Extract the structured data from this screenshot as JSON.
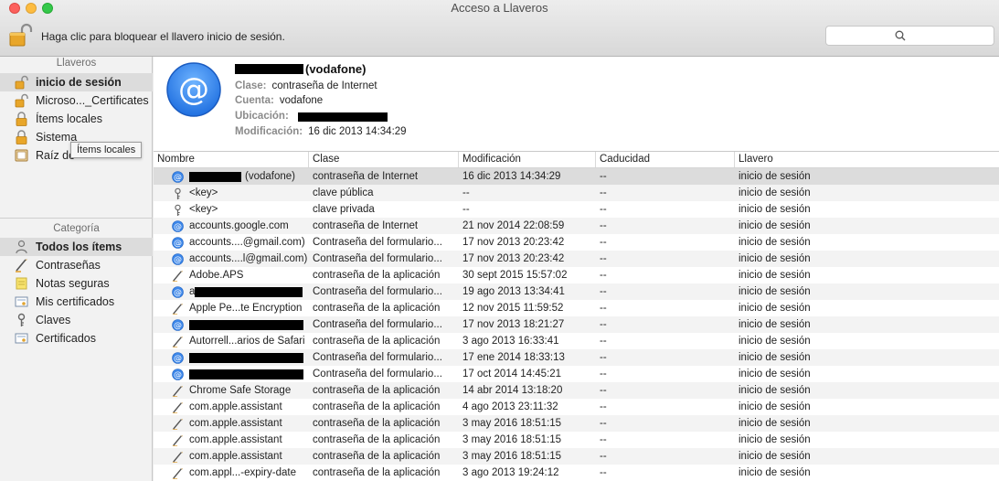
{
  "window": {
    "title": "Acceso a Llaveros"
  },
  "toolbar": {
    "lock_text": "Haga clic para bloquear el llavero inicio de sesión.",
    "search_placeholder": ""
  },
  "sidebar": {
    "keychains_header": "Llaveros",
    "keychains": [
      {
        "label": "inicio de sesión",
        "icon": "lock-open-icon",
        "selected": true
      },
      {
        "label": "Microso..._Certificates",
        "icon": "lock-open-icon",
        "selected": false
      },
      {
        "label": "Ítems locales",
        "icon": "lock-icon",
        "selected": false
      },
      {
        "label": "Sistema",
        "icon": "lock-icon",
        "selected": false
      },
      {
        "label": "Raíz de",
        "icon": "cabinet-icon",
        "selected": false
      }
    ],
    "tooltip": "Ítems locales",
    "category_header": "Categoría",
    "categories": [
      {
        "label": "Todos los ítems",
        "icon": "people-icon",
        "selected": true
      },
      {
        "label": "Contraseñas",
        "icon": "pen-icon",
        "selected": false
      },
      {
        "label": "Notas seguras",
        "icon": "note-icon",
        "selected": false
      },
      {
        "label": "Mis certificados",
        "icon": "certificate-icon",
        "selected": false
      },
      {
        "label": "Claves",
        "icon": "key-icon",
        "selected": false
      },
      {
        "label": "Certificados",
        "icon": "certificate-icon",
        "selected": false
      }
    ]
  },
  "detail": {
    "title": "(vodafone)",
    "clase_label": "Clase:",
    "clase_value": "contraseña de Internet",
    "cuenta_label": "Cuenta:",
    "cuenta_value": "vodafone",
    "ubicacion_label": "Ubicación:",
    "modificacion_label": "Modificación:",
    "modificacion_value": "16 dic 2013 14:34:29"
  },
  "table": {
    "columns": [
      "Nombre",
      "Clase",
      "Modificación",
      "Caducidad",
      "Llavero"
    ],
    "rows": [
      {
        "name": "(vodafone)",
        "redact": "pre",
        "icon": "at-icon",
        "clase": "contraseña de Internet",
        "mod": "16 dic 2013 14:34:29",
        "cad": "--",
        "llavero": "inicio de sesión",
        "selected": true
      },
      {
        "name": "<key>",
        "icon": "key-icon",
        "clase": "clave pública",
        "mod": "--",
        "cad": "--",
        "llavero": "inicio de sesión"
      },
      {
        "name": "<key>",
        "icon": "key-icon",
        "clase": "clave privada",
        "mod": "--",
        "cad": "--",
        "llavero": "inicio de sesión"
      },
      {
        "name": "accounts.google.com",
        "icon": "at-icon",
        "clase": "contraseña de Internet",
        "mod": "21 nov 2014 22:08:59",
        "cad": "--",
        "llavero": "inicio de sesión"
      },
      {
        "name": "accounts....@gmail.com)",
        "icon": "at-icon",
        "clase": "Contraseña del formulario...",
        "mod": "17 nov 2013 20:23:42",
        "cad": "--",
        "llavero": "inicio de sesión"
      },
      {
        "name": "accounts....l@gmail.com)",
        "icon": "at-icon",
        "clase": "Contraseña del formulario...",
        "mod": "17 nov 2013 20:23:42",
        "cad": "--",
        "llavero": "inicio de sesión"
      },
      {
        "name": "Adobe.APS",
        "icon": "pen-icon",
        "clase": "contraseña de la aplicación",
        "mod": "30 sept 2015 15:57:02",
        "cad": "--",
        "llavero": "inicio de sesión"
      },
      {
        "name": "a",
        "redact": "post",
        "icon": "at-icon",
        "clase": "Contraseña del formulario...",
        "mod": "19 ago 2013 13:34:41",
        "cad": "--",
        "llavero": "inicio de sesión"
      },
      {
        "name": "Apple Pe...te Encryption",
        "icon": "pen-icon",
        "clase": "contraseña de la aplicación",
        "mod": "12 nov 2015 11:59:52",
        "cad": "--",
        "llavero": "inicio de sesión"
      },
      {
        "name": "",
        "redact": "full",
        "icon": "at-icon",
        "clase": "Contraseña del formulario...",
        "mod": "17 nov 2013 18:21:27",
        "cad": "--",
        "llavero": "inicio de sesión"
      },
      {
        "name": "Autorrell...arios de Safari",
        "icon": "pen-icon",
        "clase": "contraseña de la aplicación",
        "mod": "3 ago 2013 16:33:41",
        "cad": "--",
        "llavero": "inicio de sesión"
      },
      {
        "name": "",
        "redact": "full",
        "icon": "at-icon",
        "clase": "Contraseña del formulario...",
        "mod": "17 ene 2014 18:33:13",
        "cad": "--",
        "llavero": "inicio de sesión"
      },
      {
        "name": "",
        "redact": "full",
        "icon": "at-icon",
        "clase": "Contraseña del formulario...",
        "mod": "17 oct 2014 14:45:21",
        "cad": "--",
        "llavero": "inicio de sesión"
      },
      {
        "name": "Chrome Safe Storage",
        "icon": "pen-icon",
        "clase": "contraseña de la aplicación",
        "mod": "14 abr 2014 13:18:20",
        "cad": "--",
        "llavero": "inicio de sesión"
      },
      {
        "name": "com.apple.assistant",
        "icon": "pen-icon",
        "clase": "contraseña de la aplicación",
        "mod": "4 ago 2013 23:11:32",
        "cad": "--",
        "llavero": "inicio de sesión"
      },
      {
        "name": "com.apple.assistant",
        "icon": "pen-icon",
        "clase": "contraseña de la aplicación",
        "mod": "3 may 2016 18:51:15",
        "cad": "--",
        "llavero": "inicio de sesión"
      },
      {
        "name": "com.apple.assistant",
        "icon": "pen-icon",
        "clase": "contraseña de la aplicación",
        "mod": "3 may 2016 18:51:15",
        "cad": "--",
        "llavero": "inicio de sesión"
      },
      {
        "name": "com.apple.assistant",
        "icon": "pen-icon",
        "clase": "contraseña de la aplicación",
        "mod": "3 may 2016 18:51:15",
        "cad": "--",
        "llavero": "inicio de sesión"
      },
      {
        "name": "com.appl...-expiry-date",
        "icon": "pen-icon",
        "clase": "contraseña de la aplicación",
        "mod": "3 ago 2013 19:24:12",
        "cad": "--",
        "llavero": "inicio de sesión"
      }
    ]
  }
}
